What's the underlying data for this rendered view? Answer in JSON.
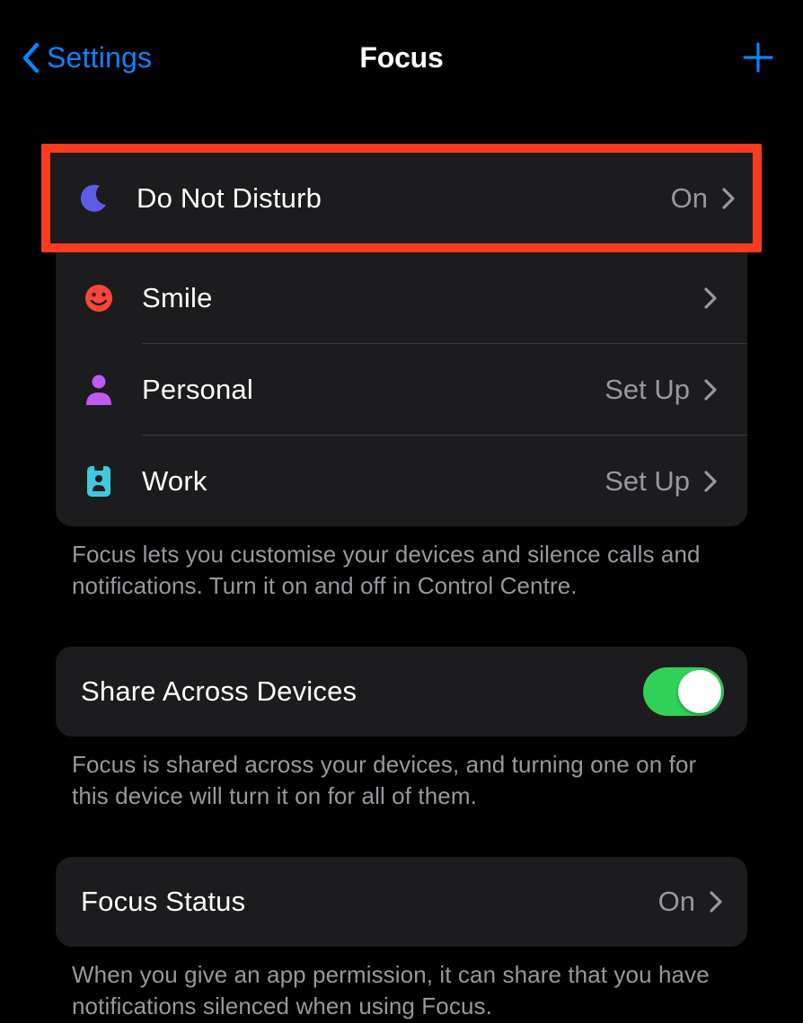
{
  "nav": {
    "back_label": "Settings",
    "title": "Focus"
  },
  "focus_modes": [
    {
      "icon": "moon-icon",
      "label": "Do Not Disturb",
      "value": "On"
    },
    {
      "icon": "smile-icon",
      "label": "Smile",
      "value": ""
    },
    {
      "icon": "person-icon",
      "label": "Personal",
      "value": "Set Up"
    },
    {
      "icon": "badge-icon",
      "label": "Work",
      "value": "Set Up"
    }
  ],
  "focus_footer": "Focus lets you customise your devices and silence calls and notifications. Turn it on and off in Control Centre.",
  "share": {
    "label": "Share Across Devices",
    "footer": "Focus is shared across your devices, and turning one on for this device will turn it on for all of them.",
    "enabled": true
  },
  "status": {
    "label": "Focus Status",
    "value": "On",
    "footer": "When you give an app permission, it can share that you have notifications silenced when using Focus."
  },
  "highlight_index": 0,
  "colors": {
    "accent": "#0a84ff",
    "highlight_border": "#ff3b1f",
    "toggle_on": "#30d158"
  }
}
